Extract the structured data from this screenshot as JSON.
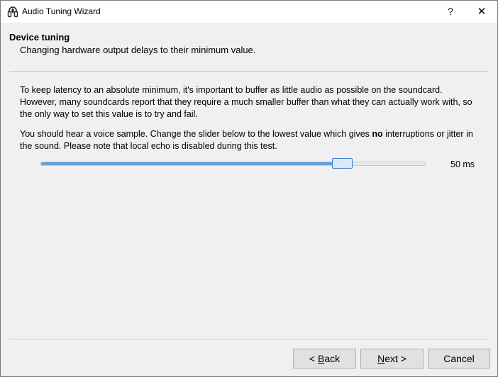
{
  "window": {
    "title": "Audio Tuning Wizard",
    "help_glyph": "?",
    "close_glyph": "✕"
  },
  "header": {
    "title": "Device tuning",
    "subtitle": "Changing hardware output delays to their minimum value."
  },
  "body": {
    "para1": "To keep latency to an absolute minimum, it's important to buffer as little audio as possible on the soundcard. However, many soundcards report that they require a much smaller buffer than what they can actually work with, so the only way to set this value is to try and fail.",
    "para2_before": "You should hear a voice sample. Change the slider below to the lowest value which gives ",
    "para2_bold": "no",
    "para2_after": " interruptions or jitter in the sound. Please note that local echo is disabled during this test."
  },
  "slider": {
    "value_label": "50 ms",
    "fill_fraction": 0.78
  },
  "buttons": {
    "back_prefix": "< ",
    "back_mnemonic": "B",
    "back_rest": "ack",
    "next_mnemonic": "N",
    "next_rest": "ext >",
    "cancel": "Cancel"
  }
}
